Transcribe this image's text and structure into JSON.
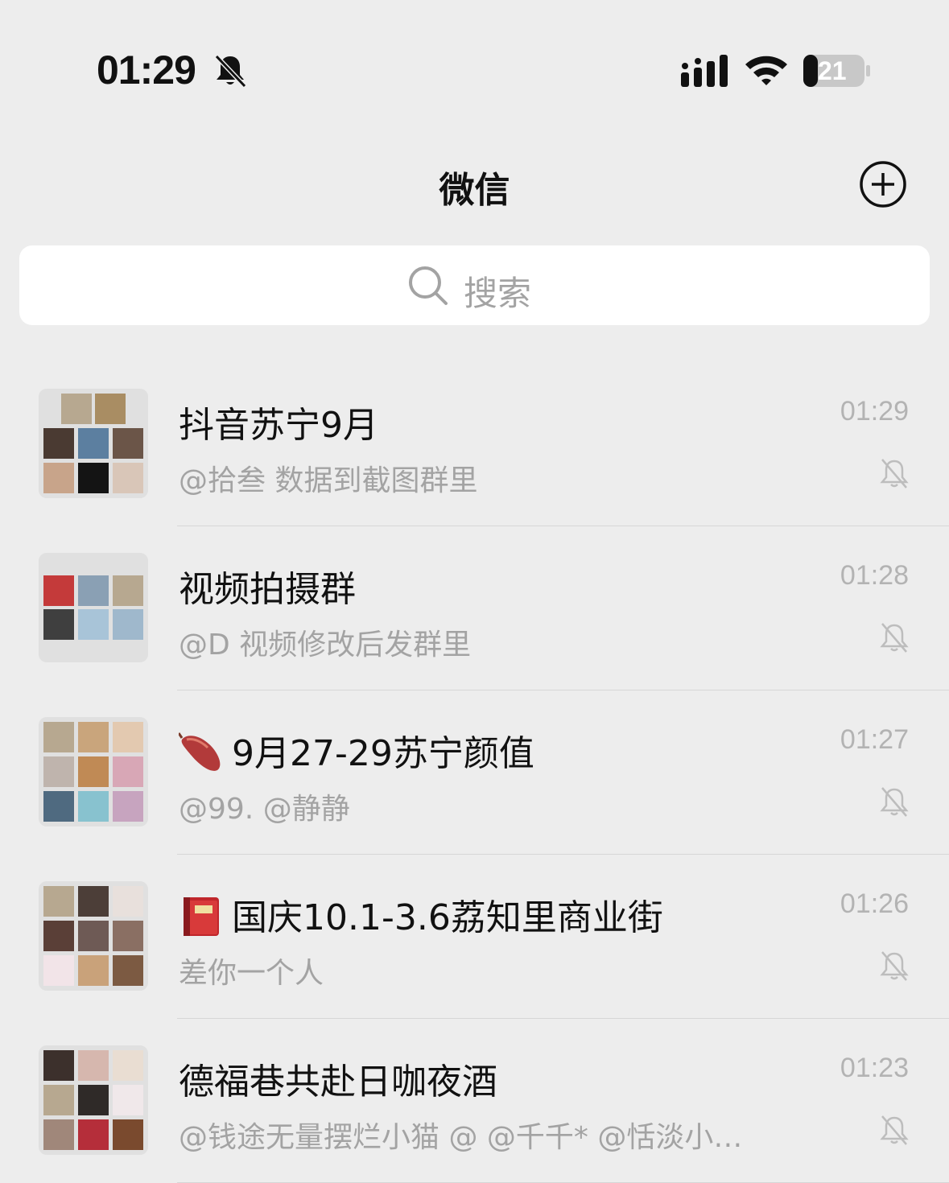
{
  "status_bar": {
    "time": "01:29",
    "battery_level": "21",
    "icons": [
      "bell-off-icon",
      "signal-icon",
      "wifi-icon",
      "battery-icon"
    ]
  },
  "header": {
    "title": "微信",
    "add_icon": "plus-circle-icon"
  },
  "search": {
    "placeholder": "搜索"
  },
  "chats": [
    {
      "name": "抖音苏宁9月",
      "preview": "@拾叁 数据到截图群里",
      "time": "01:29",
      "muted": true,
      "emoji": ""
    },
    {
      "name": "视频拍摄群",
      "preview": "@D 视频修改后发群里",
      "time": "01:28",
      "muted": true,
      "emoji": ""
    },
    {
      "name": "9月27-29苏宁颜值",
      "preview": "@99. @静静",
      "time": "01:27",
      "muted": true,
      "emoji": "sweet-potato-icon"
    },
    {
      "name": "国庆10.1-3.6荔知里商业街",
      "preview": "差你一个人",
      "time": "01:26",
      "muted": true,
      "emoji": "red-book-icon"
    },
    {
      "name": "德福巷共赴日咖夜酒",
      "preview": "@钱途无量摆烂小猫 @      @千千* @恬淡小…",
      "time": "01:23",
      "muted": true,
      "emoji": ""
    }
  ],
  "colors": {
    "background": "#ededed",
    "search_bg": "#ffffff",
    "secondary_text": "#a3a3a3"
  }
}
